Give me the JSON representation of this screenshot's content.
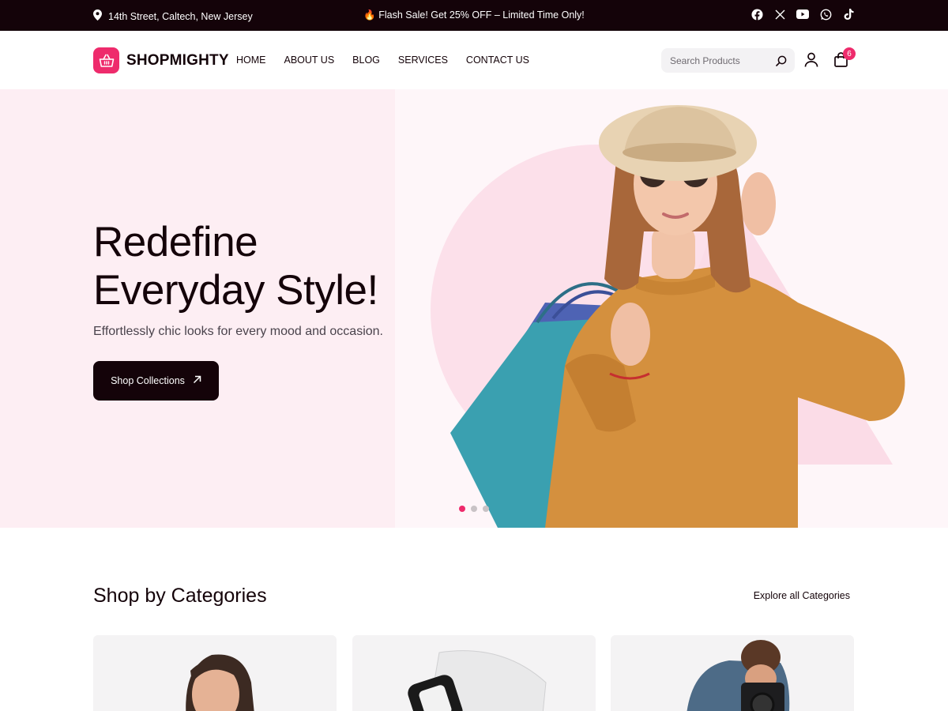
{
  "topbar": {
    "address": "14th Street, Caltech, New Jersey",
    "flash": "🔥 Flash Sale! Get 25% OFF – Limited Time Only!",
    "social_icons": [
      "facebook-icon",
      "x-twitter-icon",
      "youtube-icon",
      "whatsapp-icon",
      "tiktok-icon"
    ]
  },
  "header": {
    "brand": "SHOPMIGHTY",
    "nav": [
      "HOME",
      "ABOUT US",
      "BLOG",
      "SERVICES",
      "CONTACT US"
    ],
    "search_placeholder": "Search Products",
    "cart_count": "6"
  },
  "hero": {
    "title_line1": "Redefine",
    "title_line2": "Everyday Style!",
    "subtitle": "Effortlessly chic looks for every mood and occasion.",
    "cta": "Shop Collections",
    "slides": 3,
    "active_slide": 1
  },
  "categories": {
    "title": "Shop by Categories",
    "explore_link": "Explore all Categories"
  },
  "colors": {
    "brand": "#ee2b6c",
    "dark": "#140309",
    "hero_bg": "#fdeef3"
  }
}
